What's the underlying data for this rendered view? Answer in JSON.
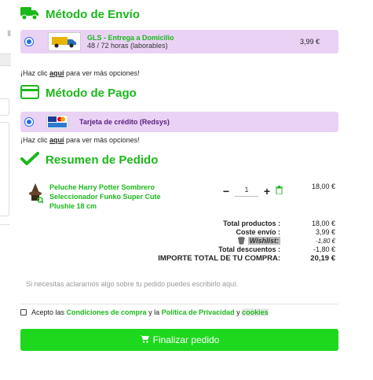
{
  "left_strip": {
    "fragment": "Ⅱ"
  },
  "shipping": {
    "title": "Método de Envío",
    "option": {
      "name": "GLS - Entrega a Domicilio",
      "detail": "48 / 72 horas (laborables)",
      "price": "3,99 €"
    },
    "more_prefix": "¡Haz clic ",
    "more_link": "aquí",
    "more_suffix": " para ver más opciones!"
  },
  "payment": {
    "title": "Método de Pago",
    "option": {
      "name": "Tarjeta de crédito (Redsys)"
    },
    "more_prefix": "¡Haz clic ",
    "more_link": "aquí",
    "more_suffix": " para ver más opciones!"
  },
  "summary": {
    "title": "Resumen de Pedido",
    "product": {
      "name": "Peluche Harry Potter Sombrero Seleccionador Funko Super Cute Plushie 18 cm",
      "quantity": "1",
      "price": "18,00 €"
    },
    "totals": {
      "products_label": "Total productos :",
      "products_value": "18,00 €",
      "shipping_label": "Coste envío :",
      "shipping_value": "3,99 €",
      "wishlist_label": "Wishlist:",
      "wishlist_value": "-1,80 €",
      "discounts_label": "Total descuentos :",
      "discounts_value": "-1,80 €",
      "grand_label": "IMPORTE TOTAL DE TU COMPRA:",
      "grand_value": "20,19 €"
    },
    "note": "Si necesitas aclararnos algo sobre tu pedido puedes escribirlo aquí."
  },
  "terms": {
    "prefix": "Acepto las ",
    "conditions": "Condiciones de compra",
    "and1": " y la ",
    "privacy": "Política de Privacidad",
    "and2": " y ",
    "cookies": "cookies"
  },
  "checkout_button": "Finalizar pedido",
  "colors": {
    "accent": "#1bb81b",
    "option_bg": "#ead2f5",
    "cta": "#1ed81e",
    "radio": "#1e6ef0"
  }
}
